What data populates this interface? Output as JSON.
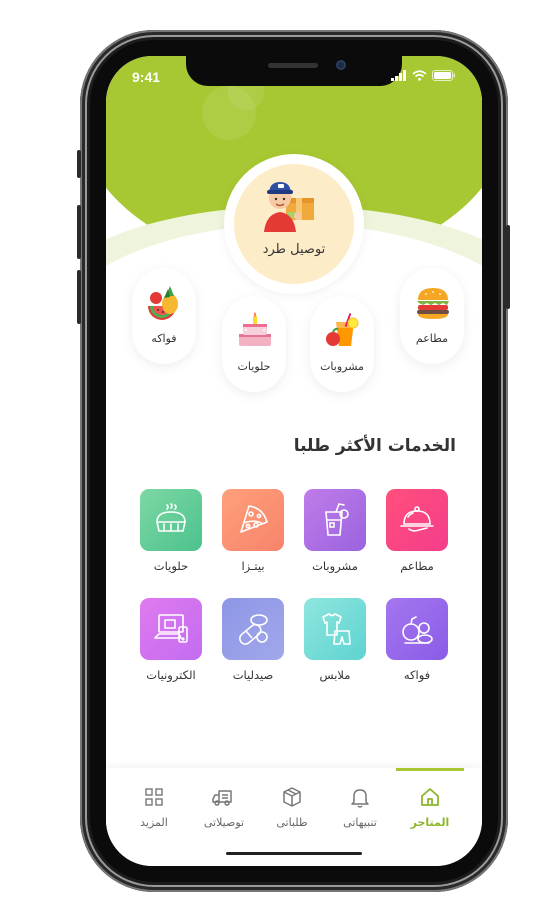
{
  "status": {
    "time": "9:41"
  },
  "featured": {
    "label": "توصيل طرد"
  },
  "categories": [
    {
      "label": "فواكه",
      "icon": "fruits-icon"
    },
    {
      "label": "حلويات",
      "icon": "cake-icon"
    },
    {
      "label": "مشروبات",
      "icon": "drink-icon"
    },
    {
      "label": "مطاعم",
      "icon": "burger-icon"
    }
  ],
  "section": {
    "title": "الخدمات الأكثر طلبا"
  },
  "services": [
    {
      "label": "مطاعم",
      "icon": "food-cloche-icon",
      "color_from": "#ff4f7b",
      "color_to": "#f53d8c"
    },
    {
      "label": "مشروبات",
      "icon": "drink-cup-icon",
      "color_from": "#c07ce8",
      "color_to": "#9a63e0"
    },
    {
      "label": "بيتـزا",
      "icon": "pizza-icon",
      "color_from": "#ffa07a",
      "color_to": "#f7836b"
    },
    {
      "label": "حلويات",
      "icon": "cake-dome-icon",
      "color_from": "#7dd8a4",
      "color_to": "#4cc28d"
    },
    {
      "label": "فواكه",
      "icon": "fruit-basket-icon",
      "color_from": "#a576f0",
      "color_to": "#8a5ce6"
    },
    {
      "label": "ملابس",
      "icon": "clothes-icon",
      "color_from": "#8fe6df",
      "color_to": "#5ed3d0"
    },
    {
      "label": "صيدليات",
      "icon": "pills-icon",
      "color_from": "#8e97e6",
      "color_to": "#a1a7ea"
    },
    {
      "label": "الكترونيات",
      "icon": "devices-icon",
      "color_from": "#e07af0",
      "color_to": "#c26cf0"
    }
  ],
  "nav": [
    {
      "label": "المتاجر",
      "icon": "home-icon",
      "active": true
    },
    {
      "label": "تنبيهاتى",
      "icon": "bell-icon",
      "active": false
    },
    {
      "label": "طلباتى",
      "icon": "box-icon",
      "active": false
    },
    {
      "label": "توصيلاتى",
      "icon": "truck-icon",
      "active": false
    },
    {
      "label": "المزيد",
      "icon": "grid-icon",
      "active": false
    }
  ],
  "colors": {
    "accent": "#a7c832",
    "active_nav": "#8bb62a"
  }
}
